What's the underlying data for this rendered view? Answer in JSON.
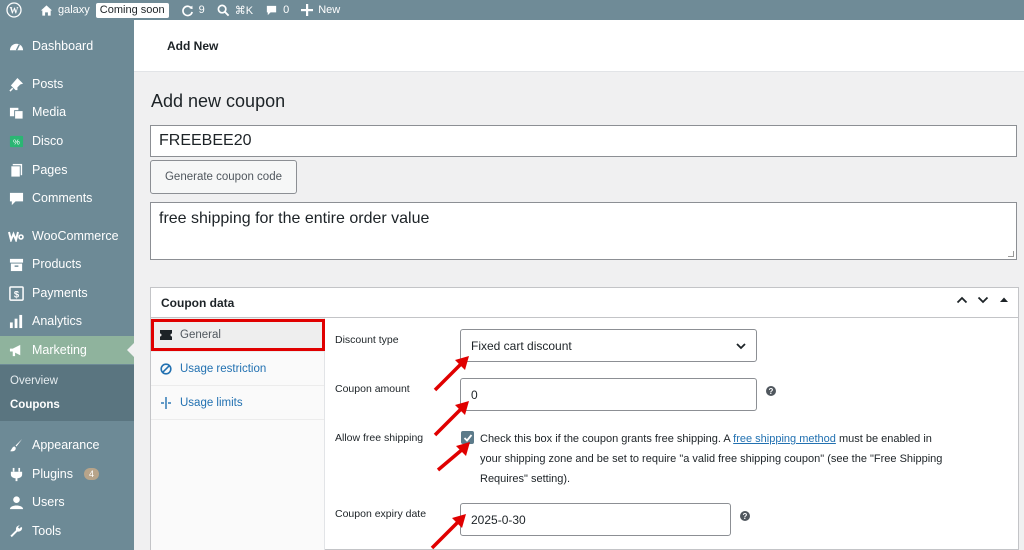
{
  "admin_bar": {
    "site_name": "galaxy",
    "status_badge": "Coming soon",
    "updates_count": "9",
    "search_shortcut": "⌘K",
    "comments_count": "0",
    "new_label": "New"
  },
  "sidebar": {
    "items": [
      {
        "label": "Dashboard",
        "icon": "dashboard-icon"
      },
      {
        "label": "Posts",
        "icon": "pin-icon"
      },
      {
        "label": "Media",
        "icon": "media-icon"
      },
      {
        "label": "Disco",
        "icon": "disco-icon"
      },
      {
        "label": "Pages",
        "icon": "pages-icon"
      },
      {
        "label": "Comments",
        "icon": "comment-icon"
      },
      {
        "label": "WooCommerce",
        "icon": "woo-icon"
      },
      {
        "label": "Products",
        "icon": "archive-icon"
      },
      {
        "label": "Payments",
        "icon": "dollar-icon"
      },
      {
        "label": "Analytics",
        "icon": "bar-chart-icon"
      },
      {
        "label": "Marketing",
        "icon": "megaphone-icon"
      },
      {
        "label": "Appearance",
        "icon": "brush-icon"
      },
      {
        "label": "Plugins",
        "icon": "plug-icon",
        "badge": "4"
      },
      {
        "label": "Users",
        "icon": "user-icon"
      },
      {
        "label": "Tools",
        "icon": "wrench-icon"
      }
    ],
    "submenu": [
      {
        "label": "Overview"
      },
      {
        "label": "Coupons"
      }
    ]
  },
  "header": {
    "title": "Add New"
  },
  "page": {
    "title": "Add new coupon",
    "coupon_code": "FREEBEE20",
    "generate_button": "Generate coupon code",
    "description": "free shipping for the entire order value"
  },
  "coupon_panel": {
    "title": "Coupon data",
    "tabs": [
      {
        "label": "General",
        "icon": "ticket-icon"
      },
      {
        "label": "Usage restriction",
        "icon": "ban-icon"
      },
      {
        "label": "Usage limits",
        "icon": "limits-icon"
      }
    ],
    "fields": {
      "discount_type_label": "Discount type",
      "discount_type_value": "Fixed cart discount",
      "amount_label": "Coupon amount",
      "amount_value": "0",
      "free_shipping_label": "Allow free shipping",
      "free_shipping_checked": true,
      "free_shipping_text_before": "Check this box if the coupon grants free shipping. A ",
      "free_shipping_link": "free shipping method",
      "free_shipping_text_after": " must be enabled in your shipping zone and be set to require \"a valid free shipping coupon\" (see the \"Free Shipping Requires\" setting).",
      "expiry_label": "Coupon expiry date",
      "expiry_value": "2025-0-30"
    }
  },
  "colors": {
    "sidebar": "#6d8a96",
    "active_menu": "#8fb39d",
    "link": "#2271b1",
    "highlight": "#e00000"
  }
}
